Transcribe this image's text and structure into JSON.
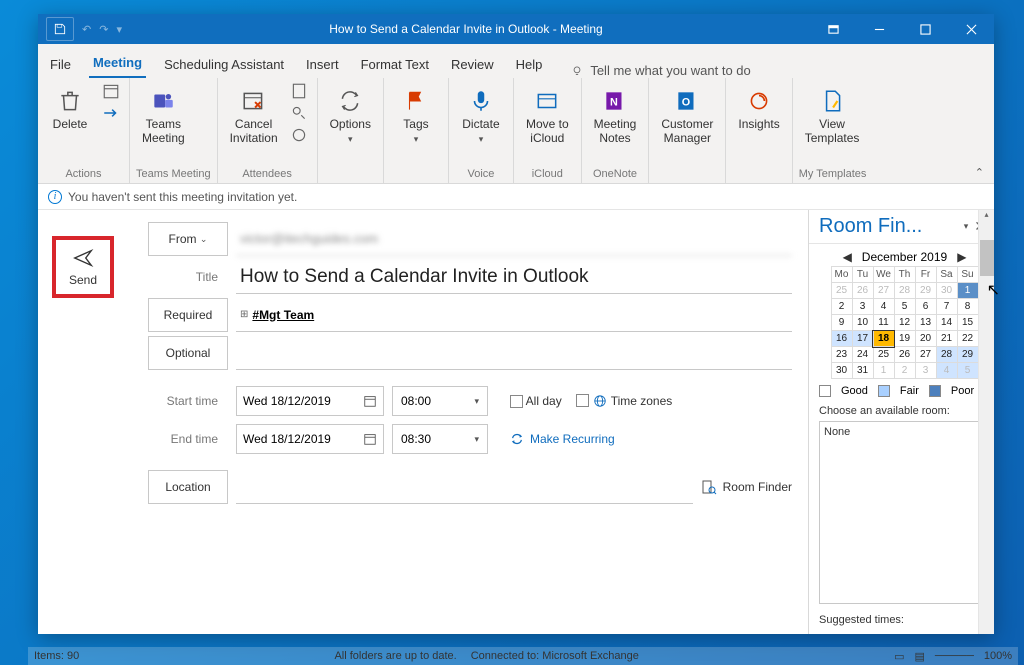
{
  "titlebar": {
    "title": "How to Send a Calendar Invite in Outlook  -  Meeting"
  },
  "menu": {
    "file": "File",
    "meeting": "Meeting",
    "scheduling": "Scheduling Assistant",
    "insert": "Insert",
    "format": "Format Text",
    "review": "Review",
    "help": "Help",
    "tellme": "Tell me what you want to do"
  },
  "ribbon": {
    "delete": "Delete",
    "actions_group": "Actions",
    "teams": "Teams\nMeeting",
    "teams_group": "Teams Meeting",
    "cancel": "Cancel\nInvitation",
    "attendees_group": "Attendees",
    "options": "Options",
    "tags": "Tags",
    "dictate": "Dictate",
    "voice_group": "Voice",
    "moveto": "Move to\niCloud",
    "icloud_group": "iCloud",
    "meetingnotes": "Meeting\nNotes",
    "onenote_group": "OneNote",
    "customermgr": "Customer\nManager",
    "insights": "Insights",
    "viewtpl": "View\nTemplates",
    "mytpl_group": "My Templates"
  },
  "infobar": {
    "text": "You haven't sent this meeting invitation yet."
  },
  "send": {
    "label": "Send"
  },
  "fields": {
    "from": "From",
    "from_value": "victor@itechguides.com",
    "title_label": "Title",
    "title_value": "How to Send a Calendar Invite in Outlook",
    "required": "Required",
    "required_chip": "#Mgt Team",
    "optional": "Optional",
    "start": "Start time",
    "start_date": "Wed 18/12/2019",
    "start_time": "08:00",
    "allday": "All day",
    "timezones": "Time zones",
    "end": "End time",
    "end_date": "Wed 18/12/2019",
    "end_time": "08:30",
    "recurring": "Make Recurring",
    "location": "Location",
    "roomfinder": "Room Finder"
  },
  "rightpane": {
    "title": "Room Fin...",
    "month": "December 2019",
    "dow": [
      "Mo",
      "Tu",
      "We",
      "Th",
      "Fr",
      "Sa",
      "Su"
    ],
    "grid": [
      [
        {
          "d": "25",
          "o": 1
        },
        {
          "d": "26",
          "o": 1
        },
        {
          "d": "27",
          "o": 1
        },
        {
          "d": "28",
          "o": 1
        },
        {
          "d": "29",
          "o": 1
        },
        {
          "d": "30",
          "o": 1
        },
        {
          "d": "1",
          "c": "poor"
        }
      ],
      [
        {
          "d": "2"
        },
        {
          "d": "3"
        },
        {
          "d": "4"
        },
        {
          "d": "5"
        },
        {
          "d": "6"
        },
        {
          "d": "7"
        },
        {
          "d": "8"
        }
      ],
      [
        {
          "d": "9"
        },
        {
          "d": "10"
        },
        {
          "d": "11"
        },
        {
          "d": "12"
        },
        {
          "d": "13"
        },
        {
          "d": "14"
        },
        {
          "d": "15"
        }
      ],
      [
        {
          "d": "16",
          "c": "fair"
        },
        {
          "d": "17",
          "c": "fair"
        },
        {
          "d": "18",
          "c": "sel"
        },
        {
          "d": "19"
        },
        {
          "d": "20"
        },
        {
          "d": "21"
        },
        {
          "d": "22"
        }
      ],
      [
        {
          "d": "23"
        },
        {
          "d": "24"
        },
        {
          "d": "25"
        },
        {
          "d": "26"
        },
        {
          "d": "27"
        },
        {
          "d": "28",
          "c": "fair"
        },
        {
          "d": "29",
          "c": "fair"
        }
      ],
      [
        {
          "d": "30"
        },
        {
          "d": "31"
        },
        {
          "d": "1",
          "o": 1
        },
        {
          "d": "2",
          "o": 1
        },
        {
          "d": "3",
          "o": 1
        },
        {
          "d": "4",
          "o": 1,
          "c": "fair"
        },
        {
          "d": "5",
          "o": 1,
          "c": "fair"
        }
      ]
    ],
    "good": "Good",
    "fair": "Fair",
    "poor": "Poor",
    "choose": "Choose an available room:",
    "none": "None",
    "suggested": "Suggested times:"
  },
  "statusbar": {
    "items": "Items: 90",
    "folders": "All folders are up to date.",
    "connected": "Connected to: Microsoft Exchange",
    "zoom": "100%"
  }
}
